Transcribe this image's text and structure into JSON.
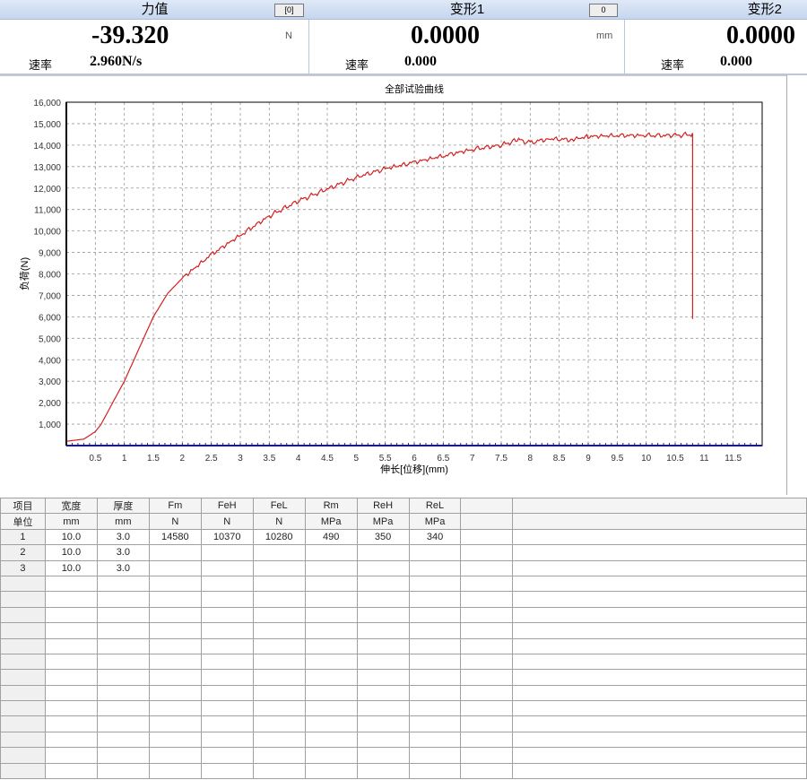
{
  "channels": [
    {
      "title": "力值",
      "value": "-39.320",
      "unit": "N",
      "rate_label": "速率",
      "rate": "2.960N/s",
      "button": "[0]"
    },
    {
      "title": "变形1",
      "value": "0.0000",
      "unit": "mm",
      "rate_label": "速率",
      "rate": "0.000",
      "button": "0"
    },
    {
      "title": "变形2",
      "value": "0.0000",
      "unit": "",
      "rate_label": "速率",
      "rate": "0.000"
    }
  ],
  "chart_data": {
    "type": "line",
    "title": "全部试验曲线",
    "xlabel": "伸长[位移](mm)",
    "ylabel": "负荷(N)",
    "xlim": [
      0,
      12
    ],
    "ylim": [
      0,
      16000
    ],
    "grid": true,
    "xticks": [
      "0.5",
      "1",
      "1.5",
      "2",
      "2.5",
      "3",
      "3.5",
      "4",
      "4.5",
      "5",
      "5.5",
      "6",
      "6.5",
      "7",
      "7.5",
      "8",
      "8.5",
      "9",
      "9.5",
      "10",
      "10.5",
      "11",
      "11.5"
    ],
    "yticks": [
      "1,000",
      "2,000",
      "3,000",
      "4,000",
      "5,000",
      "6,000",
      "7,000",
      "8,000",
      "9,000",
      "10,000",
      "11,000",
      "12,000",
      "13,000",
      "14,000",
      "15,000",
      "16,000"
    ],
    "series": [
      {
        "name": "curve",
        "color": "#d42020",
        "x": [
          0,
          0.3,
          0.5,
          0.6,
          1,
          1.5,
          1.75,
          2,
          2.5,
          3,
          3.5,
          4,
          4.5,
          5,
          5.5,
          6,
          6.5,
          7,
          7.5,
          7.8,
          8,
          8.3,
          8.7,
          9,
          9.5,
          10,
          10.5,
          10.8,
          10.8
        ],
        "y": [
          200,
          300,
          650,
          1000,
          3000,
          6000,
          7100,
          7800,
          8900,
          9800,
          10700,
          11400,
          11950,
          12500,
          12900,
          13200,
          13500,
          13800,
          14000,
          14250,
          14100,
          14300,
          14250,
          14400,
          14450,
          14450,
          14450,
          14500,
          5900
        ]
      }
    ]
  },
  "table": {
    "headers": [
      "项目",
      "宽度",
      "厚度",
      "Fm",
      "FeH",
      "FeL",
      "Rm",
      "ReH",
      "ReL",
      "",
      ""
    ],
    "units": [
      "单位",
      "mm",
      "mm",
      "N",
      "N",
      "N",
      "MPa",
      "MPa",
      "MPa",
      "",
      ""
    ],
    "rows": [
      [
        "1",
        "10.0",
        "3.0",
        "14580",
        "10370",
        "10280",
        "490",
        "350",
        "340",
        "",
        ""
      ],
      [
        "2",
        "10.0",
        "3.0",
        "",
        "",
        "",
        "",
        "",
        "",
        "",
        ""
      ],
      [
        "3",
        "10.0",
        "3.0",
        "",
        "",
        "",
        "",
        "",
        "",
        "",
        ""
      ]
    ]
  }
}
